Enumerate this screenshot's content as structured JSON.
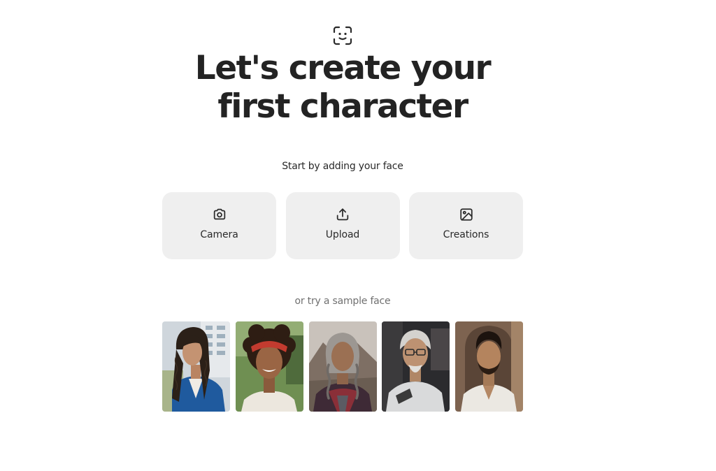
{
  "header": {
    "icon": "face-scan-icon",
    "title": "Let's create your first character",
    "subtitle": "Start by adding your face"
  },
  "options": [
    {
      "label": "Camera",
      "icon": "camera-icon"
    },
    {
      "label": "Upload",
      "icon": "upload-icon"
    },
    {
      "label": "Creations",
      "icon": "image-icon"
    }
  ],
  "samples": {
    "caption": "or try a sample face"
  }
}
